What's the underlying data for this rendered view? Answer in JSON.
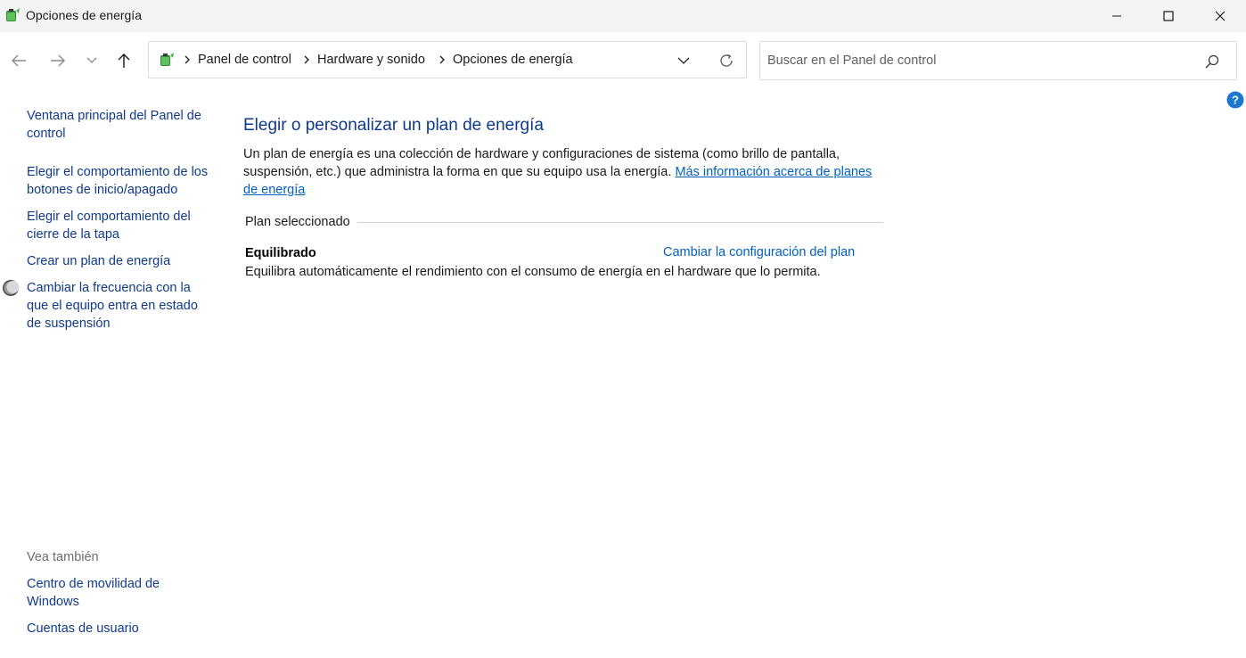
{
  "window": {
    "title": "Opciones de energía"
  },
  "address": {
    "crumbs": [
      "Panel de control",
      "Hardware y sonido",
      "Opciones de energía"
    ]
  },
  "search": {
    "placeholder": "Buscar en el Panel de control",
    "value": ""
  },
  "sidebar": {
    "links": [
      "Ventana principal del Panel de control",
      "Elegir el comportamiento de los botones de inicio/apagado",
      "Elegir el comportamiento del cierre de la tapa",
      "Crear un plan de energía",
      "Cambiar la frecuencia con la que el equipo entra en estado de suspensión"
    ],
    "see_also_label": "Vea también",
    "see_also": [
      "Centro de movilidad de Windows",
      "Cuentas de usuario"
    ]
  },
  "main": {
    "heading": "Elegir o personalizar un plan de energía",
    "description": "Un plan de energía es una colección de hardware y configuraciones de sistema (como brillo de pantalla, suspensión, etc.) que administra la forma en que su equipo usa la energía.",
    "more_info_link": "Más información acerca de planes de energía",
    "section_label": "Plan seleccionado",
    "plan": {
      "name": "Equilibrado",
      "change_link": "Cambiar la configuración del plan",
      "description": "Equilibra automáticamente el rendimiento con el consumo de energía en el hardware que lo permita."
    }
  },
  "colors": {
    "link": "#0f3a8a",
    "accent_link": "#0060c0",
    "help": "#1a78d0"
  },
  "icons": {
    "app": "power-options-icon",
    "back": "back-arrow-icon",
    "forward": "forward-arrow-icon",
    "recent": "chevron-down-icon",
    "up": "up-arrow-icon",
    "refresh": "refresh-icon",
    "search": "search-icon",
    "help": "help-icon",
    "sleep": "moon-icon"
  }
}
